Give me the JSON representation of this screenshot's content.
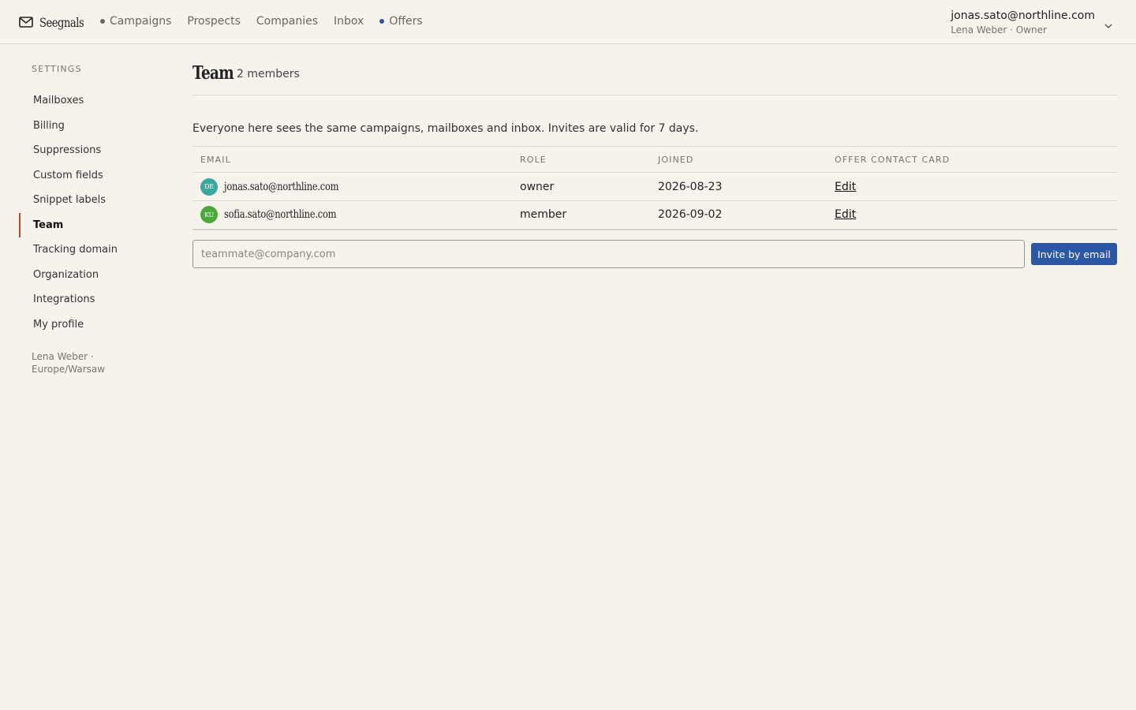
{
  "app": {
    "name": "Seegnals"
  },
  "nav": {
    "items": [
      {
        "label": "Campaigns",
        "dot": true,
        "dot_color": "#6a6660"
      },
      {
        "label": "Prospects",
        "dot": false
      },
      {
        "label": "Companies",
        "dot": false
      },
      {
        "label": "Inbox",
        "dot": false
      },
      {
        "label": "Offers",
        "dot": true,
        "dot_color": "#2b57a4"
      }
    ]
  },
  "user": {
    "email": "jonas.sato@northline.com",
    "subtitle": "Lena Weber · Owner"
  },
  "sidebar": {
    "heading": "SETTINGS",
    "items": [
      {
        "label": "Mailboxes"
      },
      {
        "label": "Billing"
      },
      {
        "label": "Suppressions"
      },
      {
        "label": "Custom fields"
      },
      {
        "label": "Snippet labels"
      },
      {
        "label": "Team",
        "active": true
      },
      {
        "label": "Tracking domain"
      },
      {
        "label": "Organization"
      },
      {
        "label": "Integrations"
      },
      {
        "label": "My profile"
      }
    ],
    "footer": "Lena Weber · Europe/Warsaw"
  },
  "main": {
    "title": "Team",
    "member_count": "2 members",
    "intro": "Everyone here sees the same campaigns, mailboxes and inbox. Invites are valid for 7 days.",
    "table": {
      "columns": [
        "EMAIL",
        "ROLE",
        "JOINED",
        "OFFER CONTACT CARD"
      ],
      "rows": [
        {
          "initials": "DE",
          "avatar_color": "#3aa89e",
          "email": "jonas.sato@northline.com",
          "role": "owner",
          "joined": "2026-08-23",
          "action": "Edit"
        },
        {
          "initials": "KU",
          "avatar_color": "#4aa83a",
          "email": "sofia.sato@northline.com",
          "role": "member",
          "joined": "2026-09-02",
          "action": "Edit"
        }
      ]
    },
    "invite": {
      "placeholder": "teammate@company.com",
      "value": "",
      "button_label": "Invite by email"
    }
  },
  "colors": {
    "background": "#f6f3ed",
    "accent": "#2b57a4",
    "active_marker": "#b24a2e"
  }
}
